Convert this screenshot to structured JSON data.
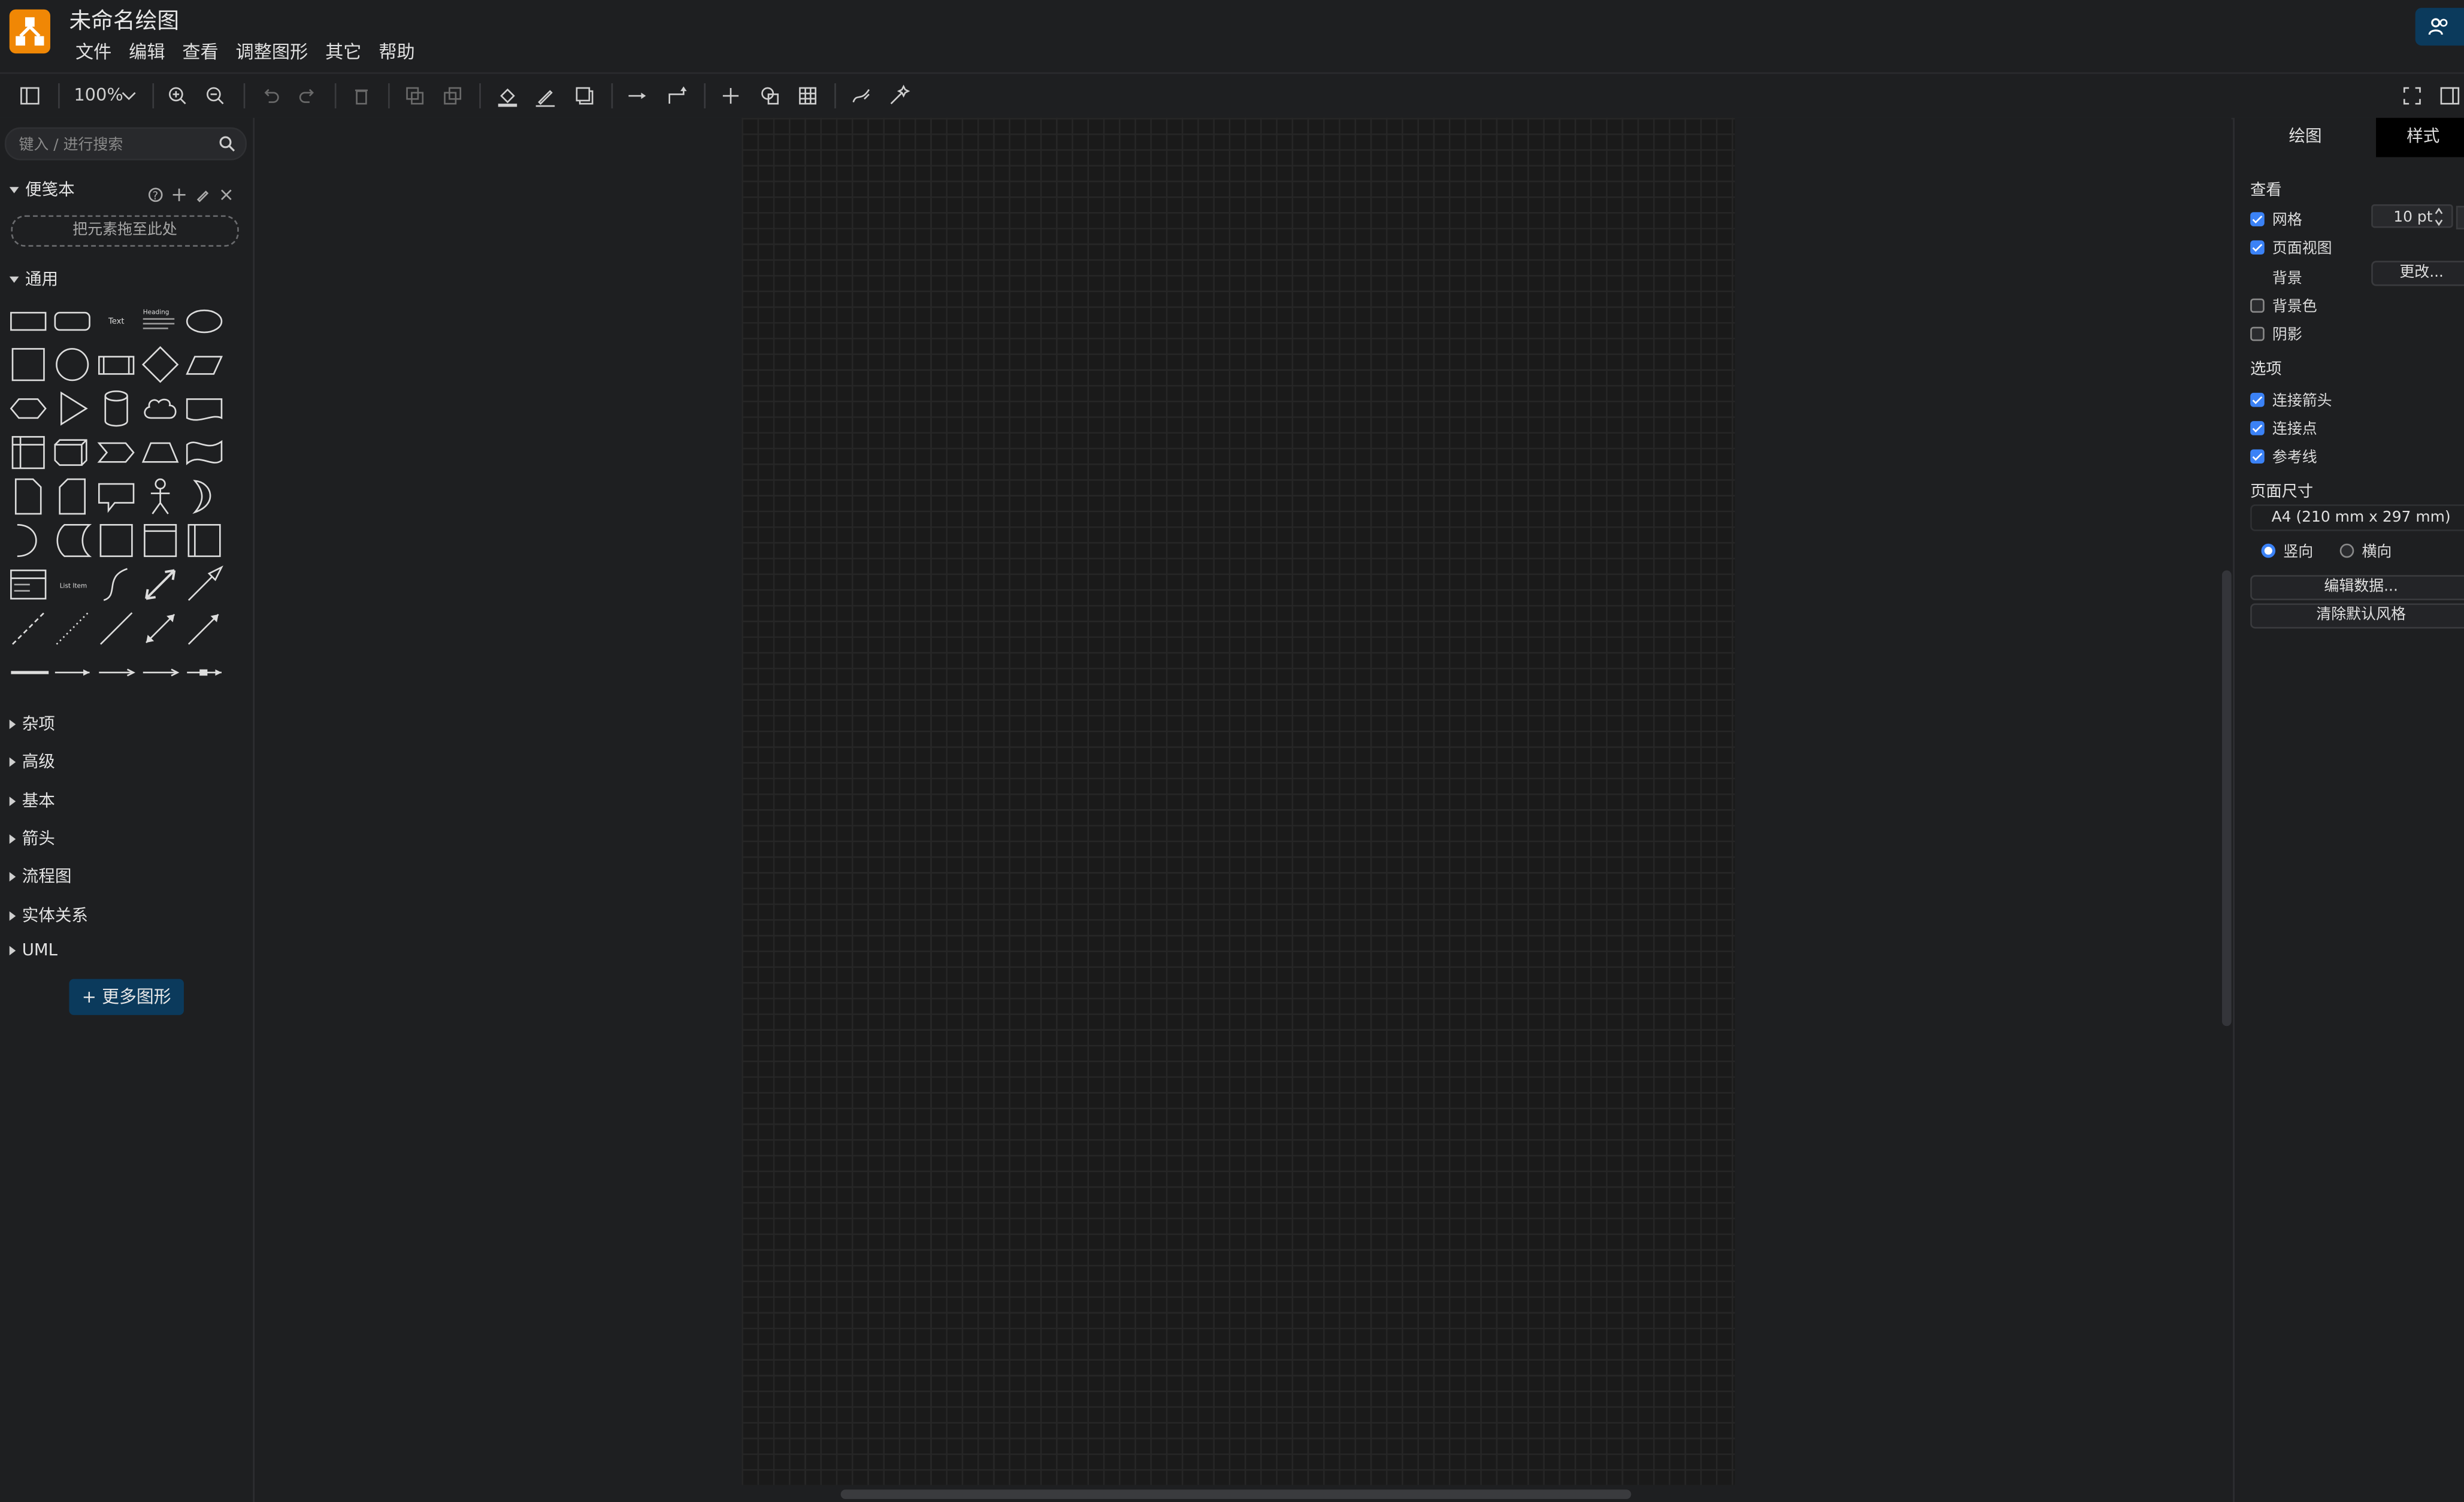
{
  "app": {
    "title": "未命名绘图",
    "menu": [
      "文件",
      "编辑",
      "查看",
      "调整图形",
      "其它",
      "帮助"
    ]
  },
  "toolbar": {
    "zoom": "100%"
  },
  "sidebar": {
    "search_placeholder": "键入 / 进行搜索",
    "scratchpad": {
      "title": "便笺本",
      "dropzone": "把元素拖至此处"
    },
    "general": {
      "title": "通用"
    },
    "collapsed_sections": [
      "杂项",
      "高级",
      "基本",
      "箭头",
      "流程图",
      "实体关系",
      "UML"
    ],
    "more_shapes": "+ 更多图形"
  },
  "panel": {
    "tabs": [
      "绘图",
      "样式"
    ],
    "view": {
      "title": "查看",
      "grid": {
        "label": "网格",
        "checked": true,
        "size": "10 pt"
      },
      "page_view": {
        "label": "页面视图",
        "checked": true
      },
      "background": {
        "label": "背景",
        "button": "更改..."
      },
      "background_color": {
        "label": "背景色",
        "checked": false
      },
      "shadow": {
        "label": "阴影",
        "checked": false
      }
    },
    "options": {
      "title": "选项",
      "connection_arrows": {
        "label": "连接箭头",
        "checked": true
      },
      "connection_points": {
        "label": "连接点",
        "checked": true
      },
      "guides": {
        "label": "参考线",
        "checked": true
      }
    },
    "page_size": {
      "title": "页面尺寸",
      "value": "A4 (210 mm x 297 mm)",
      "portrait": "竖向",
      "landscape": "横向"
    },
    "edit_data": "编辑数据...",
    "clear_style": "清除默认风格"
  },
  "colors": {
    "accent": "#f08705",
    "primary": "#0b3a5c",
    "check": "#3b82f6"
  }
}
